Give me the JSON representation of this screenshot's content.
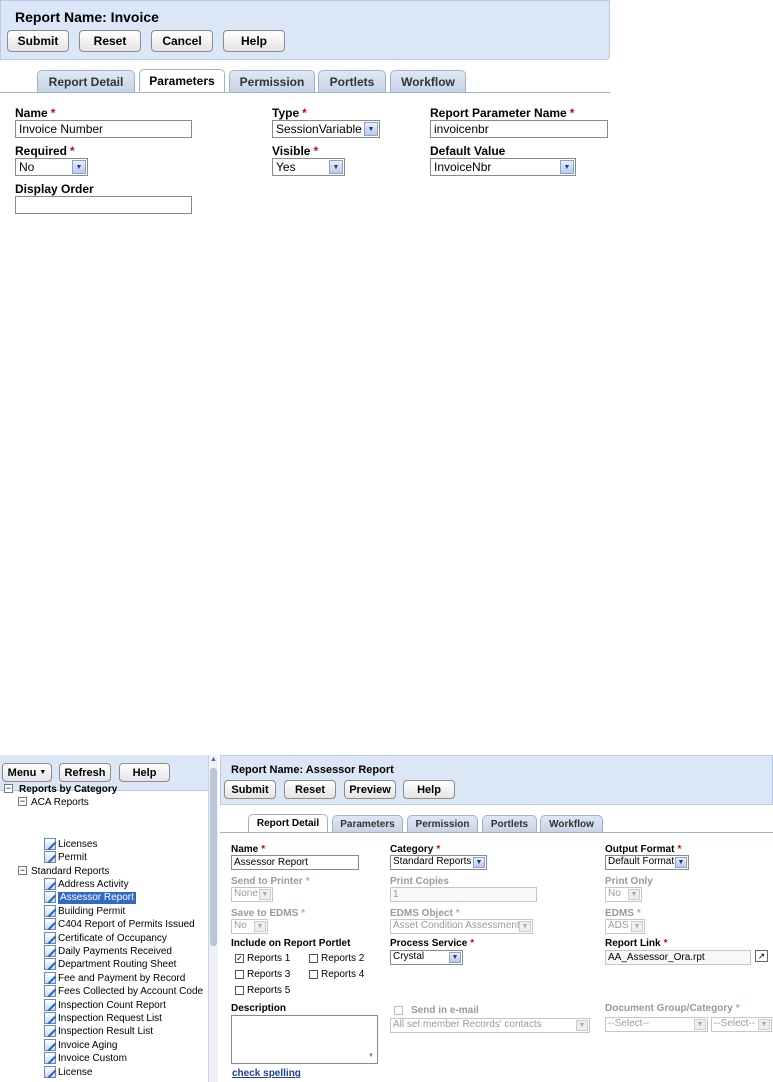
{
  "top": {
    "report_name": "Report Name: Invoice",
    "buttons": {
      "submit": "Submit",
      "reset": "Reset",
      "cancel": "Cancel",
      "help": "Help"
    },
    "tabs": [
      "Report Detail",
      "Parameters",
      "Permission",
      "Portlets",
      "Workflow"
    ],
    "active_tab": "Parameters",
    "fields": {
      "name": {
        "label": "Name",
        "value": "Invoice Number"
      },
      "type": {
        "label": "Type",
        "value": "SessionVariable"
      },
      "param_name": {
        "label": "Report Parameter Name",
        "value": "invoicenbr"
      },
      "required": {
        "label": "Required",
        "value": "No"
      },
      "visible": {
        "label": "Visible",
        "value": "Yes"
      },
      "default_value": {
        "label": "Default Value",
        "value": "InvoiceNbr"
      },
      "display_order": {
        "label": "Display Order",
        "value": ""
      }
    },
    "required_mark": "*"
  },
  "bottom": {
    "sidebar": {
      "buttons": {
        "menu": "Menu",
        "refresh": "Refresh",
        "help": "Help"
      },
      "tree_root": "Reports by Category",
      "aca_group": "ACA Reports",
      "aca_items": [
        "Licenses",
        "Permit"
      ],
      "standard_group": "Standard Reports",
      "standard_items": [
        "Address Activity",
        "Assessor Report",
        "Building Permit",
        "C404 Report of Permits Issued",
        "Certificate of Occupancy",
        "Daily Payments Received",
        "Department Routing Sheet",
        "Fee and Payment by Record",
        "Fees Collected by Account Code",
        "Inspection Count Report",
        "Inspection Request List",
        "Inspection Result List",
        "Invoice Aging",
        "Invoice Custom",
        "License"
      ],
      "selected_item": "Assessor Report"
    },
    "report_name": "Report Name: Assessor Report",
    "buttons": {
      "submit": "Submit",
      "reset": "Reset",
      "preview": "Preview",
      "help": "Help"
    },
    "tabs": [
      "Report Detail",
      "Parameters",
      "Permission",
      "Portlets",
      "Workflow"
    ],
    "active_tab": "Report Detail",
    "fields": {
      "name": {
        "label": "Name",
        "value": "Assessor Report"
      },
      "category": {
        "label": "Category",
        "value": "Standard Reports"
      },
      "output_format": {
        "label": "Output Format",
        "value": "Default Format"
      },
      "send_to_printer": {
        "label": "Send to Printer",
        "value": "None"
      },
      "print_copies": {
        "label": "Print Copies",
        "value": "1"
      },
      "print_only": {
        "label": "Print Only",
        "value": "No"
      },
      "save_to_edms": {
        "label": "Save to EDMS",
        "value": "No"
      },
      "edms_object": {
        "label": "EDMS Object",
        "value": "Asset Condition Assessment"
      },
      "edms": {
        "label": "EDMS",
        "value": "ADS"
      },
      "include_portlet": {
        "label": "Include on Report Portlet"
      },
      "process_service": {
        "label": "Process Service",
        "value": "Crystal"
      },
      "report_link": {
        "label": "Report Link",
        "value": "AA_Assessor_Ora.rpt"
      },
      "description": {
        "label": "Description",
        "value": ""
      },
      "send_email": {
        "label": "Send in e-mail",
        "value": "All set member Records' contacts"
      },
      "doc_group": {
        "label": "Document Group/Category",
        "value1": "--Select--",
        "value2": "--Select--"
      }
    },
    "portlets": [
      {
        "label": "Reports 1",
        "checked": true
      },
      {
        "label": "Reports 2",
        "checked": false
      },
      {
        "label": "Reports 3",
        "checked": false
      },
      {
        "label": "Reports 4",
        "checked": false
      },
      {
        "label": "Reports 5",
        "checked": false
      }
    ],
    "check_spelling": "check spelling",
    "required_mark": "*"
  }
}
